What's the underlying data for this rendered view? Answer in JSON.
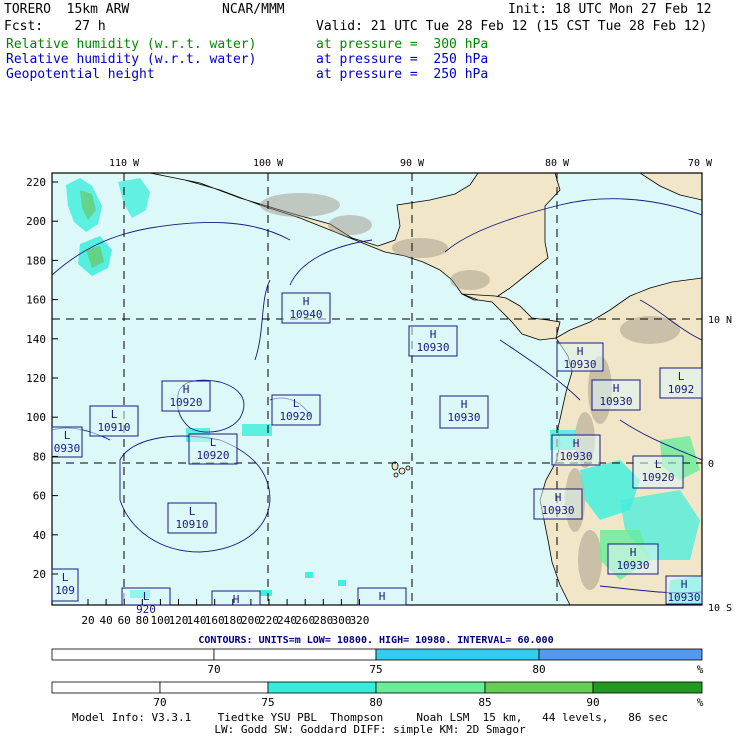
{
  "header": {
    "model": "TORERO  15km ARW",
    "org": "NCAR/MMM",
    "init": "Init: 18 UTC Mon 27 Feb 12",
    "fcst": "Fcst:    27 h",
    "valid": "Valid: 21 UTC Tue 28 Feb 12 (15 CST Tue 28 Feb 12)",
    "fields": [
      {
        "name": "Relative humidity (w.r.t. water)",
        "level": "at pressure =  300 hPa",
        "color": "#008800"
      },
      {
        "name": "Relative humidity (w.r.t. water)",
        "level": "at pressure =  250 hPa",
        "color": "#0000cc"
      },
      {
        "name": "Geopotential height",
        "level": "at pressure =  250 hPa",
        "color": "#0000cc"
      }
    ]
  },
  "map": {
    "lon_labels": [
      "110 W",
      "100 W",
      "90 W",
      "80 W",
      "70 W"
    ],
    "lat_labels": [
      "10 N",
      "0",
      "10 S"
    ],
    "x_ticks": [
      "20",
      "40",
      "60",
      "80",
      "100",
      "120",
      "140",
      "160",
      "180",
      "200",
      "220",
      "240",
      "260",
      "280",
      "300",
      "320"
    ],
    "y_ticks": [
      "220",
      "200",
      "180",
      "160",
      "140",
      "120",
      "100",
      "80",
      "60",
      "40",
      "20"
    ],
    "ocean_color": "#dcf8f8",
    "land_color": "#f2e6c8",
    "highs_lows": [
      {
        "type": "H",
        "value": "10940"
      },
      {
        "type": "H",
        "value": "10930"
      },
      {
        "type": "H",
        "value": "10930"
      },
      {
        "type": "H",
        "value": "10930"
      },
      {
        "type": "L",
        "value": "1092"
      },
      {
        "type": "H",
        "value": "10920"
      },
      {
        "type": "L",
        "value": "10920"
      },
      {
        "type": "L",
        "value": "10910"
      },
      {
        "type": "H",
        "value": "10930"
      },
      {
        "type": "L",
        "value": "10920"
      },
      {
        "type": "H",
        "value": "10930"
      },
      {
        "type": "L",
        "value": "0930"
      },
      {
        "type": "H",
        "value": "10930"
      },
      {
        "type": "L",
        "value": "10920"
      },
      {
        "type": "L",
        "value": "10910"
      },
      {
        "type": "H",
        "value": "10930"
      },
      {
        "type": "H",
        "value": "10930"
      },
      {
        "type": "L",
        "value": "109"
      },
      {
        "type": "L",
        "value": "920"
      },
      {
        "type": "H",
        "value": ""
      },
      {
        "type": "H",
        "value": ""
      },
      {
        "type": "H",
        "value": ""
      }
    ]
  },
  "contours_line": "CONTOURS:  UNITS=m  LOW=  10800.     HIGH=  10980.     INTERVAL=   60.000",
  "colorbar1": {
    "labels": [
      "70",
      "75",
      "80"
    ],
    "unit": "%",
    "colors": [
      "#ffffff",
      "#ffffff",
      "#33ccee",
      "#5599ee"
    ]
  },
  "colorbar2": {
    "labels": [
      "70",
      "75",
      "80",
      "85",
      "90"
    ],
    "unit": "%",
    "colors": [
      "#ffffff",
      "#ffffff",
      "#33eedd",
      "#66ee99",
      "#66cc55",
      "#229922"
    ]
  },
  "model_info": {
    "line1": "Model Info: V3.3.1    Tiedtke YSU PBL  Thompson     Noah LSM  15 km,   44 levels,   86 sec",
    "line2": "LW: Godd SW: Goddard DIFF: simple KM: 2D Smagor"
  }
}
